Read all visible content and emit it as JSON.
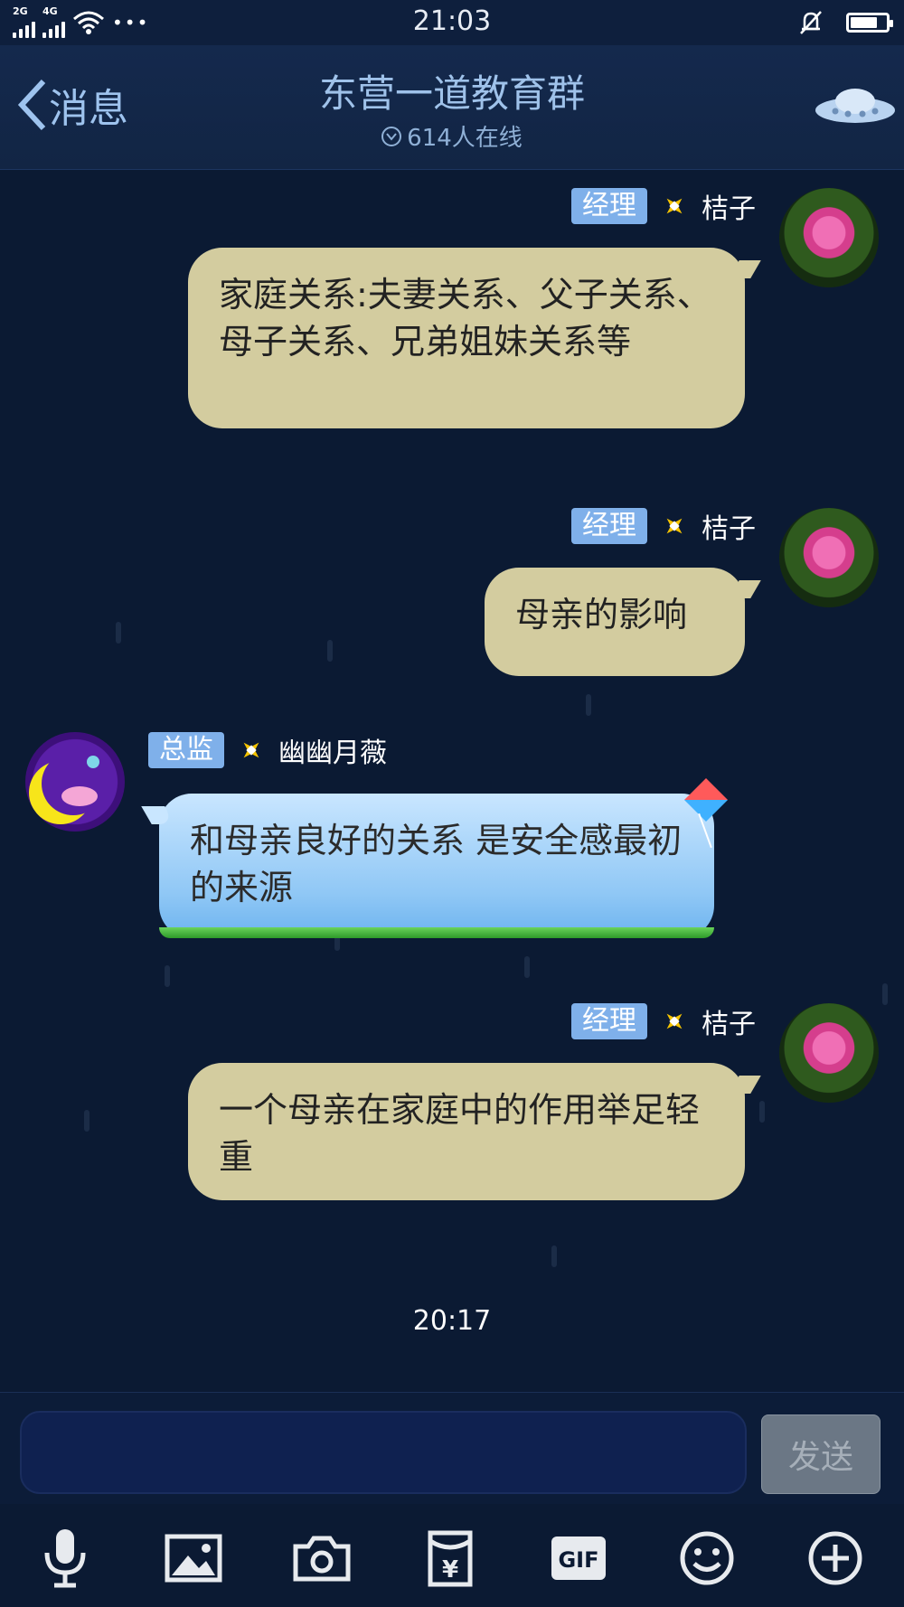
{
  "status_bar": {
    "signal_1": "2G",
    "signal_2": "4G",
    "more": "•••",
    "time": "21:03"
  },
  "header": {
    "back_label": "消息",
    "title": "东营一道教育群",
    "online": "614人在线"
  },
  "messages": [
    {
      "side": "right",
      "role": "经理",
      "name": "桔子",
      "text": "家庭关系:夫妻关系、父子关系、母子关系、兄弟姐妹关系等"
    },
    {
      "side": "right",
      "role": "经理",
      "name": "桔子",
      "text": "母亲的影响"
    },
    {
      "side": "left",
      "role": "总监",
      "name": "幽幽月薇",
      "text": "和母亲良好的关系  是安全感最初的来源"
    },
    {
      "side": "right",
      "role": "经理",
      "name": "桔子",
      "text": "一个母亲在家庭中的作用举足轻重"
    }
  ],
  "timestamp": "20:17",
  "composer": {
    "value": "",
    "send_label": "发送"
  },
  "toolbar": {
    "icons": [
      "microphone-icon",
      "image-icon",
      "camera-icon",
      "red-packet-icon",
      "gif-icon",
      "emoji-icon",
      "plus-icon"
    ],
    "gif_label": "GIF",
    "yen_label": "¥"
  },
  "colors": {
    "background": "#0b1a33",
    "bubble_own": "#d3cc9f",
    "bubble_other": "#8fc7f5",
    "role_badge": "#7fb0ea"
  }
}
